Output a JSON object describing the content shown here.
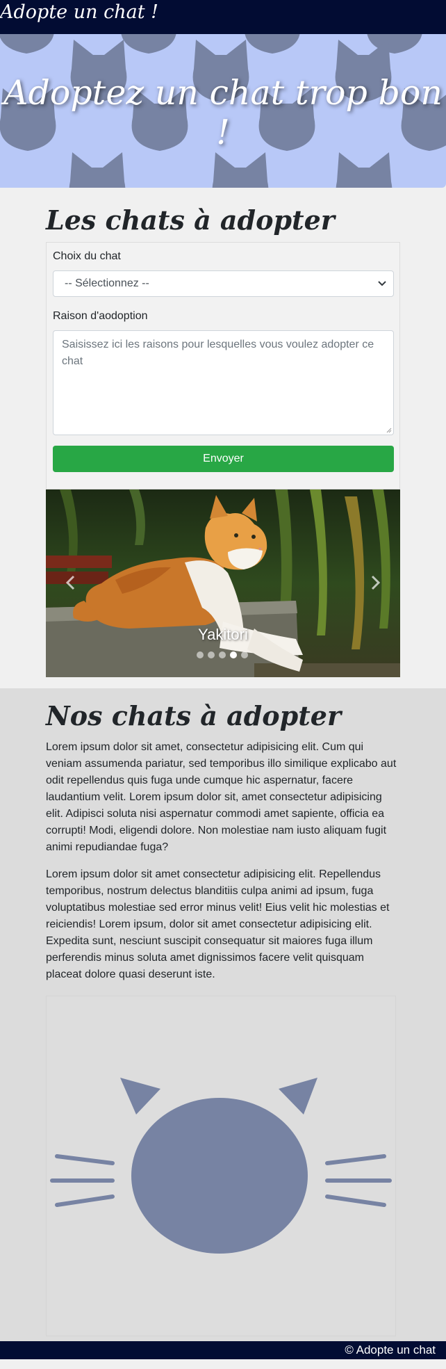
{
  "navbar": {
    "brand": "Adopte un chat !"
  },
  "hero": {
    "title": "Adoptez un chat trop bon !",
    "background_color": "#b8c8f7",
    "pattern_icon": "cat-head-icon"
  },
  "adopt_section": {
    "title": "Les chats à adopter",
    "form": {
      "cat_choice_label": "Choix du chat",
      "cat_choice_value": "-- Sélectionnez --",
      "reason_label": "Raison d'aodoption",
      "reason_placeholder": "Saisissez ici les raisons pour lesquelles vous voulez adopter ce chat",
      "submit_label": "Envoyer"
    },
    "carousel": {
      "caption": "Yakitori",
      "slide_count": 5,
      "active_index": 3,
      "prev_icon": "chevron-left-icon",
      "next_icon": "chevron-right-icon"
    }
  },
  "about_section": {
    "title": "Nos chats à adopter",
    "paragraphs": [
      "Lorem ipsum dolor sit amet, consectetur adipisicing elit. Cum qui veniam assumenda pariatur, sed temporibus illo similique explicabo aut odit repellendus quis fuga unde cumque hic aspernatur, facere laudantium velit. Lorem ipsum dolor sit, amet consectetur adipisicing elit. Adipisci soluta nisi aspernatur commodi amet sapiente, officia ea corrupti! Modi, eligendi dolore. Non molestiae nam iusto aliquam fugit animi repudiandae fuga?",
      "Lorem ipsum dolor sit amet consectetur adipisicing elit. Repellendus temporibus, nostrum delectus blanditiis culpa animi ad ipsum, fuga voluptatibus molestiae sed error minus velit! Eius velit hic molestias et reiciendis! Lorem ipsum, dolor sit amet consectetur adipisicing elit. Expedita sunt, nesciunt suscipit consequatur sit maiores fuga illum perferendis minus soluta amet dignissimos facere velit quisquam placeat dolore quasi deserunt iste."
    ],
    "illustration_icon": "cat-face-icon"
  },
  "footer": {
    "text": "© Adopte un chat"
  },
  "colors": {
    "navbar": "#020c33",
    "accent_button": "#28a745",
    "cat_silhouette": "#7783a3"
  }
}
